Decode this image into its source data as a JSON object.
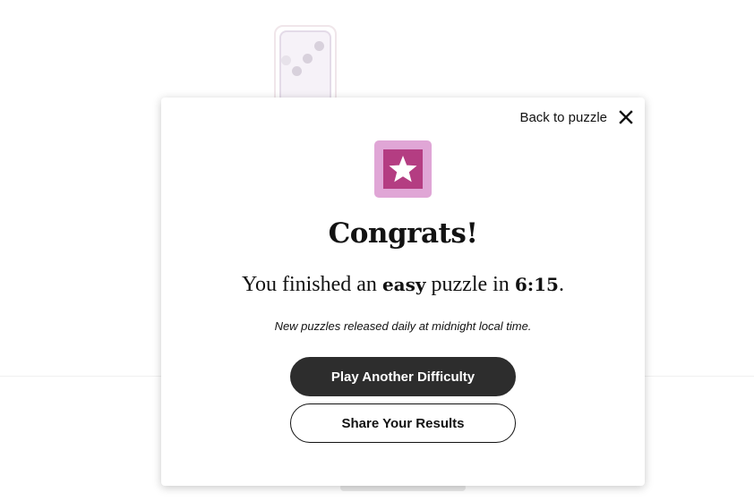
{
  "modal": {
    "back_label": "Back to puzzle",
    "close_icon": "close-icon",
    "badge_icon": "star-icon",
    "badge_colors": {
      "outer": "#e0a6d6",
      "inner": "#b43d82",
      "star": "#ffffff"
    },
    "title": "Congrats!",
    "result": {
      "prefix": "You finished an ",
      "difficulty": "easy",
      "middle": " puzzle in ",
      "time": "6:15",
      "suffix": "."
    },
    "note": "New puzzles released daily at midnight local time.",
    "primary_button": "Play Another Difficulty",
    "secondary_button": "Share Your Results"
  },
  "colors": {
    "primary_button_bg": "#2d2d2d",
    "text": "#121212"
  }
}
